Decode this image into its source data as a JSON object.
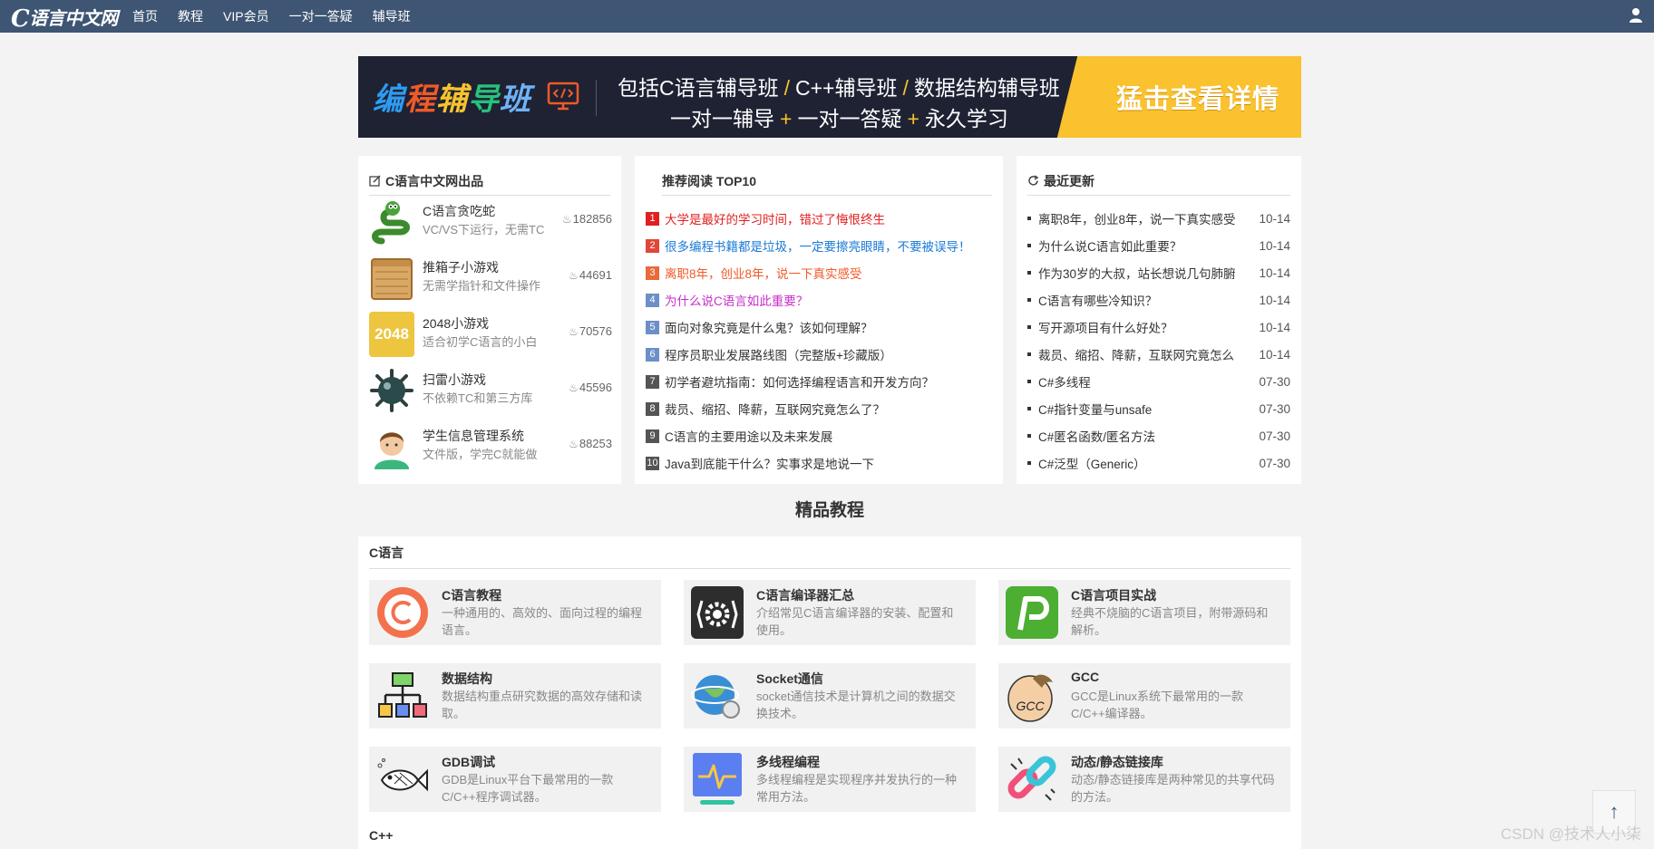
{
  "site": {
    "logo_c": "C",
    "logo_rest": "语言中文网"
  },
  "nav": {
    "items": [
      "首页",
      "教程",
      "VIP会员",
      "一对一答疑",
      "辅导班"
    ]
  },
  "banner": {
    "brand": [
      "编",
      "程",
      "辅",
      "导",
      "班"
    ],
    "line1": [
      "包括C语言辅导班",
      "/",
      "C++辅导班",
      "/",
      "数据结构辅导班"
    ],
    "line2": [
      "一对一辅导",
      "+",
      "一对一答疑",
      "+",
      "永久学习"
    ],
    "cta": "猛击查看详情"
  },
  "products_panel": {
    "title": "C语言中文网出品",
    "items": [
      {
        "name": "C语言贪吃蛇",
        "desc": "VC/VS下运行，无需TC",
        "count": "182856",
        "icon": "snake-icon"
      },
      {
        "name": "推箱子小游戏",
        "desc": "无需学指针和文件操作",
        "count": "44691",
        "icon": "box-icon"
      },
      {
        "name": "2048小游戏",
        "desc": "适合初学C语言的小白",
        "count": "70576",
        "icon": "2048-icon",
        "icon_text": "2048"
      },
      {
        "name": "扫雷小游戏",
        "desc": "不依赖TC和第三方库",
        "count": "45596",
        "icon": "mine-icon"
      },
      {
        "name": "学生信息管理系统",
        "desc": "文件版，学完C就能做",
        "count": "88253",
        "icon": "student-icon"
      }
    ]
  },
  "top10": {
    "title": "推荐阅读 TOP10",
    "items": [
      {
        "n": "1",
        "text": "大学是最好的学习时间，错过了悔恨终生",
        "color": "#e02020",
        "badge": "#e02020"
      },
      {
        "n": "2",
        "text": "很多编程书籍都是垃圾，一定要擦亮眼睛，不要被误导！",
        "color": "#1a7ad4",
        "badge": "#e0473a"
      },
      {
        "n": "3",
        "text": "离职8年，创业8年，说一下真实感受",
        "color": "#f05a28",
        "badge": "#e86a3a"
      },
      {
        "n": "4",
        "text": "为什么说C语言如此重要？",
        "color": "#c82ec8",
        "badge": "#6d8fc7"
      },
      {
        "n": "5",
        "text": "面向对象究竟是什么鬼？该如何理解？",
        "color": "#333",
        "badge": "#6d8fc7"
      },
      {
        "n": "6",
        "text": "程序员职业发展路线图（完整版+珍藏版）",
        "color": "#333",
        "badge": "#6d8fc7"
      },
      {
        "n": "7",
        "text": "初学者避坑指南：如何选择编程语言和开发方向？",
        "color": "#333",
        "badge": "#555"
      },
      {
        "n": "8",
        "text": "裁员、缩招、降薪，互联网究竟怎么了？",
        "color": "#333",
        "badge": "#555"
      },
      {
        "n": "9",
        "text": "C语言的主要用途以及未来发展",
        "color": "#333",
        "badge": "#555"
      },
      {
        "n": "10",
        "text": "Java到底能干什么？实事求是地说一下",
        "color": "#333",
        "badge": "#555"
      }
    ]
  },
  "updates": {
    "title": "最近更新",
    "items": [
      {
        "text": "离职8年，创业8年，说一下真实感受",
        "date": "10-14"
      },
      {
        "text": "为什么说C语言如此重要？",
        "date": "10-14"
      },
      {
        "text": "作为30岁的大叔，站长想说几句肺腑",
        "date": "10-14"
      },
      {
        "text": "C语言有哪些冷知识？",
        "date": "10-14"
      },
      {
        "text": "写开源项目有什么好处？",
        "date": "10-14"
      },
      {
        "text": "裁员、缩招、降薪，互联网究竟怎么",
        "date": "10-14"
      },
      {
        "text": "C#多线程",
        "date": "07-30"
      },
      {
        "text": "C#指针变量与unsafe",
        "date": "07-30"
      },
      {
        "text": "C#匿名函数/匿名方法",
        "date": "07-30"
      },
      {
        "text": "C#泛型（Generic）",
        "date": "07-30"
      }
    ]
  },
  "tutorials": {
    "heading": "精品教程",
    "category1": "C语言",
    "category2": "C++",
    "cards": [
      {
        "title": "C语言教程",
        "desc": "一种通用的、高效的、面向过程的编程语言。",
        "icon": "c-language-icon"
      },
      {
        "title": "C语言编译器汇总",
        "desc": "介绍常见C语言编译器的安装、配置和使用。",
        "icon": "compiler-gear-icon"
      },
      {
        "title": "C语言项目实战",
        "desc": "经典不烧脑的C语言项目，附带源码和解析。",
        "icon": "project-p-icon"
      },
      {
        "title": "数据结构",
        "desc": "数据结构重点研究数据的高效存储和读取。",
        "icon": "data-structure-icon"
      },
      {
        "title": "Socket通信",
        "desc": "socket通信技术是计算机之间的数据交换技术。",
        "icon": "socket-globe-icon"
      },
      {
        "title": "GCC",
        "desc": "GCC是Linux系统下最常用的一款C/C++编译器。",
        "icon": "gcc-gnu-icon",
        "icon_text": "GCC"
      },
      {
        "title": "GDB调试",
        "desc": "GDB是Linux平台下最常用的一款C/C++程序调试器。",
        "icon": "gdb-fish-icon"
      },
      {
        "title": "多线程编程",
        "desc": "多线程编程是实现程序并发执行的一种常用方法。",
        "icon": "multithread-pulse-icon"
      },
      {
        "title": "动态/静态链接库",
        "desc": "动态/静态链接库是两种常见的共享代码的方法。",
        "icon": "link-chain-icon"
      }
    ]
  },
  "back_to_top": "↑",
  "watermark": "CSDN @技术人小柒",
  "colors": {
    "nav_bg": "#3e5573",
    "banner_bg": "#1e2233",
    "cta_bg": "#f9c22e"
  }
}
